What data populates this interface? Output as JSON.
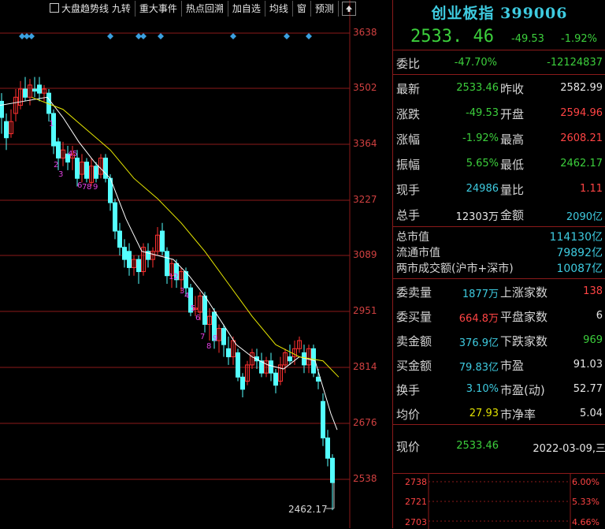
{
  "toolbar": {
    "items": [
      "大盘趋势线 九转",
      "重大事件",
      "热点回溯",
      "加自选",
      "均线",
      "窗",
      "预测"
    ]
  },
  "chart": {
    "y_ticks": [
      "3638",
      "3502",
      "3364",
      "3227",
      "3089",
      "2951",
      "2814",
      "2676",
      "2538"
    ],
    "low_label": "2462.17",
    "nine_labels_a": [
      "1",
      "2",
      "3",
      "4",
      "5",
      "6",
      "7",
      "8",
      "9"
    ],
    "nine_labels_b": [
      "1",
      "2",
      "3",
      "4",
      "5",
      "6",
      "7",
      "8",
      "9"
    ],
    "colors": {
      "up": "#ff3030",
      "down": "#54ffff",
      "ma_short": "#ffffff",
      "ma_long": "#e8e800",
      "grid": "#8b1a1a",
      "event": "#3aa0e0",
      "nine": "#e040e0"
    }
  },
  "quote": {
    "title": "创业板指 399006",
    "price": "2533. 46",
    "change": "-49.53",
    "change_pct": "-1.92%",
    "weibi_label": "委比",
    "weibi_pct": "-47.70%",
    "weibi_val": "-12124837",
    "rows": [
      {
        "l1": "最新",
        "v1": "2533.46",
        "c1": "g",
        "l2": "昨收",
        "v2": "2582.99",
        "c2": "w"
      },
      {
        "l1": "涨跌",
        "v1": "-49.53",
        "c1": "g",
        "l2": "开盘",
        "v2": "2594.96",
        "c2": "r"
      },
      {
        "l1": "涨幅",
        "v1": "-1.92%",
        "c1": "g",
        "l2": "最高",
        "v2": "2608.21",
        "c2": "r"
      },
      {
        "l1": "振幅",
        "v1": "5.65%",
        "c1": "g",
        "l2": "最低",
        "v2": "2462.17",
        "c2": "g"
      },
      {
        "l1": "现手",
        "v1": "24986",
        "c1": "c",
        "l2": "量比",
        "v2": "1.11",
        "c2": "r"
      },
      {
        "l1": "总手",
        "v1": "12303万",
        "c1": "w",
        "l2": "金额",
        "v2": "2090亿",
        "c2": "c"
      }
    ],
    "market": [
      {
        "l": "总市值",
        "v": "114130亿"
      },
      {
        "l": "流通市值",
        "v": "79892亿"
      },
      {
        "l": "两市成交额(沪市+深市)",
        "v": "10087亿"
      }
    ],
    "stats": [
      {
        "l1": "委卖量",
        "v1": "1877万",
        "c1": "c",
        "l2": "上涨家数",
        "v2": "138",
        "c2": "r"
      },
      {
        "l1": "委买量",
        "v1": "664.8万",
        "c1": "r",
        "l2": "平盘家数",
        "v2": "6",
        "c2": "w"
      },
      {
        "l1": "卖金额",
        "v1": "376.9亿",
        "c1": "c",
        "l2": "下跌家数",
        "v2": "969",
        "c2": "g"
      },
      {
        "l1": "买金额",
        "v1": "79.83亿",
        "c1": "c",
        "l2": "市盈",
        "v2": "91.03",
        "c2": "w"
      },
      {
        "l1": "换手",
        "v1": "3.10%",
        "c1": "c",
        "l2": "市盈(动)",
        "v2": "52.77",
        "c2": "w"
      },
      {
        "l1": "均价",
        "v1": "27.93",
        "c1": "y",
        "l2": "市净率",
        "v2": "5.04",
        "c2": "w"
      }
    ],
    "now_label": "现价",
    "now_value": "2533.46",
    "date": "2022-03-09,三",
    "mini_y": [
      "2738",
      "2721",
      "2703"
    ],
    "mini_pct": [
      "6.00%",
      "5.33%",
      "4.66%"
    ]
  }
}
